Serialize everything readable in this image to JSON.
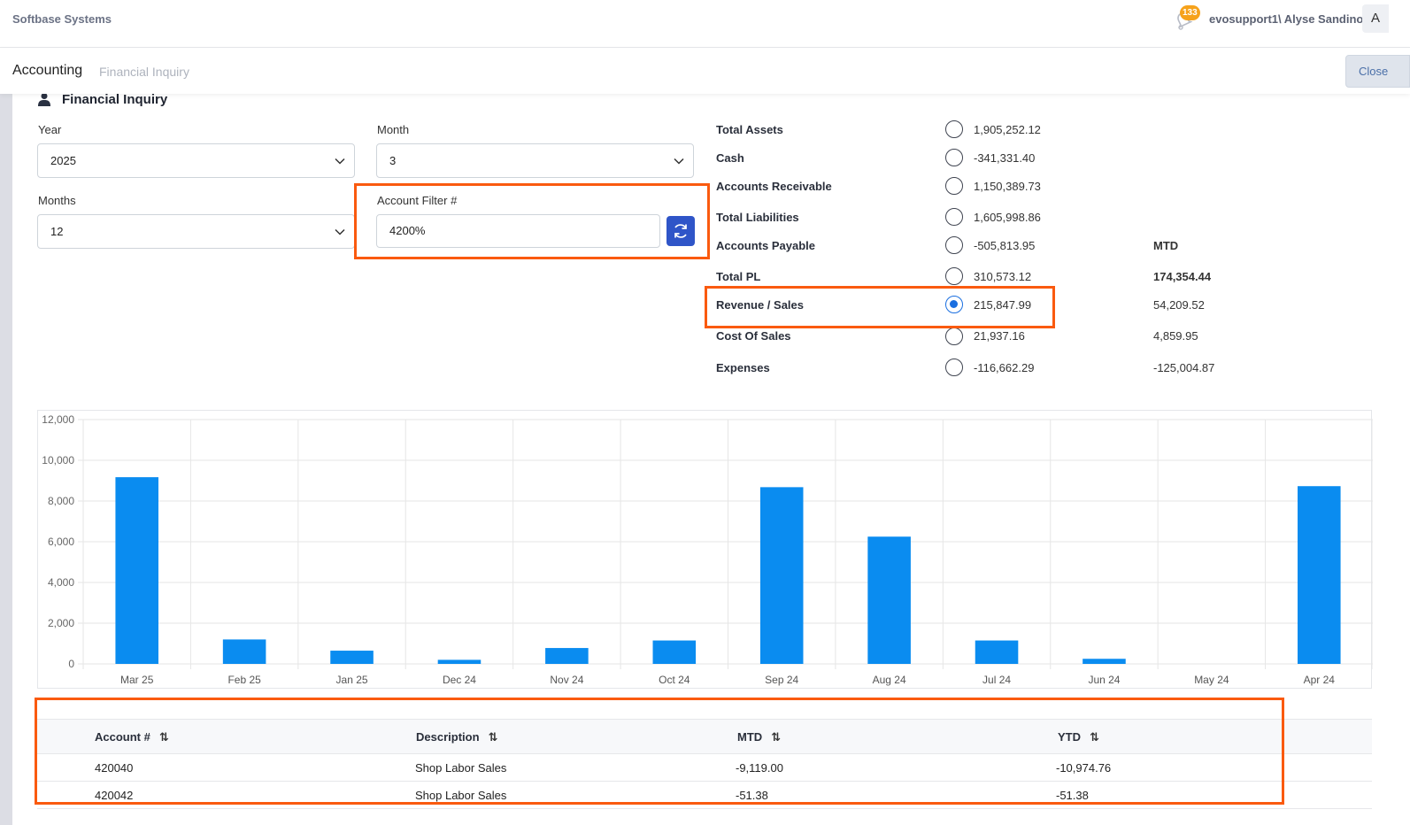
{
  "brand": "Softbase Systems",
  "header": {
    "notification_count": "133",
    "user": "evosupport1\\ Alyse Sandino",
    "avatar_letter": "A"
  },
  "breadcrumb": {
    "main": "Accounting",
    "sub": "Financial Inquiry"
  },
  "close_label": "Close",
  "panel_title": "Financial Inquiry",
  "filters": {
    "year_label": "Year",
    "year_value": "2025",
    "month_label": "Month",
    "month_value": "3",
    "months_label": "Months",
    "months_value": "12",
    "account_filter_label": "Account Filter #",
    "account_filter_value": "4200%"
  },
  "summary": {
    "mtd_header": "MTD",
    "rows": [
      {
        "label": "Total Assets",
        "value": "1,905,252.12",
        "mtd": "",
        "selected": false
      },
      {
        "label": "Cash",
        "value": "-341,331.40",
        "mtd": "",
        "selected": false
      },
      {
        "label": "Accounts Receivable",
        "value": "1,150,389.73",
        "mtd": "",
        "selected": false
      },
      {
        "label": "Total Liabilities",
        "value": "1,605,998.86",
        "mtd": "",
        "selected": false
      },
      {
        "label": "Accounts Payable",
        "value": "-505,813.95",
        "mtd": "",
        "selected": false
      },
      {
        "label": "Total PL",
        "value": "310,573.12",
        "mtd": "174,354.44",
        "selected": false
      },
      {
        "label": "Revenue / Sales",
        "value": "215,847.99",
        "mtd": "54,209.52",
        "selected": true
      },
      {
        "label": "Cost Of Sales",
        "value": "21,937.16",
        "mtd": "4,859.95",
        "selected": false
      },
      {
        "label": "Expenses",
        "value": "-116,662.29",
        "mtd": "-125,004.87",
        "selected": false
      }
    ]
  },
  "chart_data": {
    "type": "bar",
    "categories": [
      "Mar 25",
      "Feb 25",
      "Jan 25",
      "Dec 24",
      "Nov 24",
      "Oct 24",
      "Sep 24",
      "Aug 24",
      "Jul 24",
      "Jun 24",
      "May 24",
      "Apr 24"
    ],
    "values": [
      9170,
      1200,
      650,
      200,
      780,
      1150,
      8680,
      6250,
      1150,
      250,
      0,
      8730
    ],
    "ylim": [
      0,
      12000
    ],
    "yticks": [
      "0",
      "2,000",
      "4,000",
      "6,000",
      "8,000",
      "10,000",
      "12,000"
    ],
    "bar_color": "#0a8cf0",
    "grid": true
  },
  "table": {
    "headers": [
      "Account #",
      "Description",
      "MTD",
      "YTD"
    ],
    "sort_icon": "⇅",
    "rows": [
      [
        "420040",
        "Shop Labor Sales",
        "-9,119.00",
        "-10,974.76"
      ],
      [
        "420042",
        "Shop Labor Sales",
        "-51.38",
        "-51.38"
      ]
    ]
  }
}
